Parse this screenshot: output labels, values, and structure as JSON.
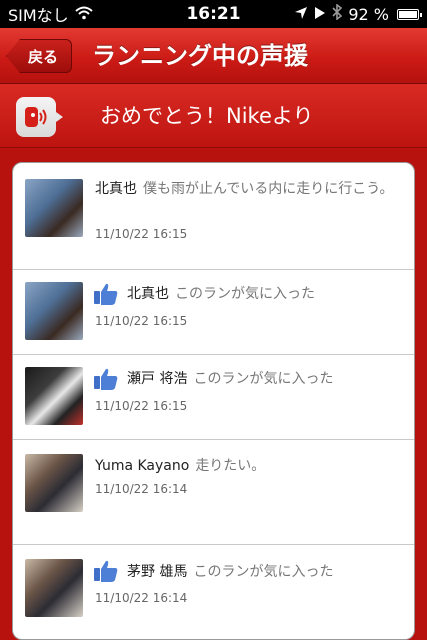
{
  "status_bar": {
    "carrier": "SIMなし",
    "time": "16:21",
    "battery": "92 %",
    "battery_level": 0.92
  },
  "nav": {
    "back_label": "戻る",
    "title": "ランニング中の声援"
  },
  "banner": {
    "text": "おめでとう！Nikeより"
  },
  "feed": [
    {
      "name": "北真也",
      "message": "僕も雨が止んでいる内に走りに行こう。",
      "time": "11/10/22  16:15",
      "liked": false
    },
    {
      "name": "北真也",
      "message": "このランが気に入った",
      "time": "11/10/22  16:15",
      "liked": true
    },
    {
      "name": "瀬戸 将浩",
      "message": "このランが気に入った",
      "time": "11/10/22  16:15",
      "liked": true
    },
    {
      "name": "Yuma  Kayano",
      "message": "走りたい。",
      "time": "11/10/22  16:14",
      "liked": false
    },
    {
      "name": "茅野 雄馬",
      "message": "このランが気に入った",
      "time": "11/10/22  16:14",
      "liked": true
    }
  ],
  "colors": {
    "nav_red": "#cc1b16",
    "background_red": "#b8120f",
    "like_blue": "#3f6fc6"
  }
}
